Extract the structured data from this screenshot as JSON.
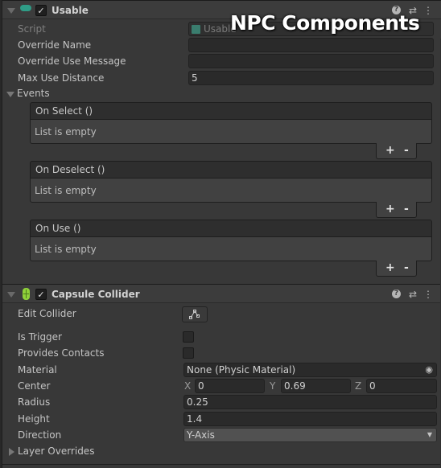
{
  "overlay": {
    "title": "NPC Components"
  },
  "usable": {
    "title": "Usable",
    "enabled": true,
    "fields": {
      "script": {
        "label": "Script",
        "value": "Usable"
      },
      "override_name": {
        "label": "Override Name",
        "value": ""
      },
      "override_use_message": {
        "label": "Override Use Message",
        "value": ""
      },
      "max_use_distance": {
        "label": "Max Use Distance",
        "value": "5"
      }
    },
    "events": {
      "label": "Events",
      "items": [
        {
          "name": "On Select ()",
          "empty_text": "List is empty"
        },
        {
          "name": "On Deselect ()",
          "empty_text": "List is empty"
        },
        {
          "name": "On Use ()",
          "empty_text": "List is empty"
        }
      ],
      "add_label": "+",
      "remove_label": "-"
    }
  },
  "capsule_collider": {
    "title": "Capsule Collider",
    "enabled": true,
    "fields": {
      "edit_collider": {
        "label": "Edit Collider"
      },
      "is_trigger": {
        "label": "Is Trigger",
        "checked": false
      },
      "provides_contacts": {
        "label": "Provides Contacts",
        "checked": false
      },
      "material": {
        "label": "Material",
        "value": "None (Physic Material)"
      },
      "center": {
        "label": "Center",
        "x_label": "X",
        "x": "0",
        "y_label": "Y",
        "y": "0.69",
        "z_label": "Z",
        "z": "0"
      },
      "radius": {
        "label": "Radius",
        "value": "0.25"
      },
      "height": {
        "label": "Height",
        "value": "1.4"
      },
      "direction": {
        "label": "Direction",
        "value": "Y-Axis"
      },
      "layer_overrides": {
        "label": "Layer Overrides"
      }
    }
  },
  "icons": {
    "help": "?",
    "presets": "⇄",
    "more": "⋮",
    "check": "✓",
    "target": "◉",
    "dropdown": "▼"
  },
  "colors": {
    "usable_icon": "#2f9c86",
    "collider_icon": "#8fd13a",
    "script_icon": "#3a7d6e"
  }
}
